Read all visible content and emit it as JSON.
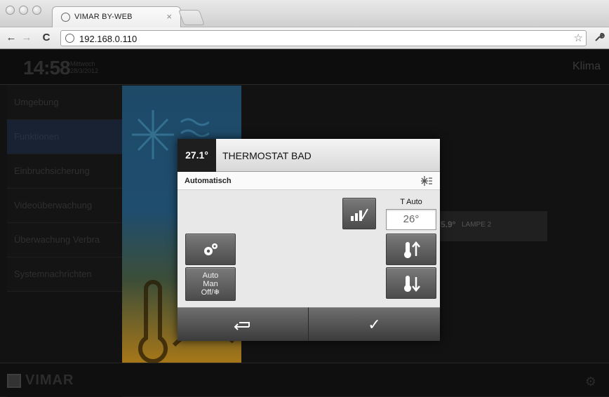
{
  "browser": {
    "tab_title": "VIMAR BY-WEB",
    "tab_close": "×",
    "url": "192.168.0.110",
    "nav_back": "←",
    "nav_forward": "→",
    "nav_reload": "C",
    "star": "☆",
    "wrench": "🔧"
  },
  "header": {
    "time": "14:58",
    "weekday": "Mittwoch",
    "date": "28/3/2012",
    "title": "Klima"
  },
  "sidebar": {
    "items": [
      {
        "label": "Umgebung"
      },
      {
        "label": "Funktionen"
      },
      {
        "label": "Einbruchsicherung"
      },
      {
        "label": "Videoüberwachung"
      },
      {
        "label": "Überwachung Verbra"
      },
      {
        "label": "Systemnachrichten"
      }
    ],
    "active_index": 1
  },
  "background_tile": {
    "temp": "5.9°",
    "label": "LAMPE 2"
  },
  "footer": {
    "logo_text": "VIMAR"
  },
  "dialog": {
    "temp": "27.1°",
    "title": "THERMOSTAT BAD",
    "mode_label": "Automatisch",
    "t_auto_label": "T Auto",
    "t_auto_value": "26°",
    "mode_button": {
      "line1": "Auto",
      "line2": "Man",
      "line3": "Off/❄"
    },
    "back_icon": "⮌",
    "ok_icon": "✓"
  },
  "colors": {
    "dialog_bg": "#e8e8e8",
    "button_dark": "#4b4b4b",
    "sidebar_active": "#182232",
    "cold_art": "#1f4d6e",
    "hot_art": "#a97818"
  }
}
